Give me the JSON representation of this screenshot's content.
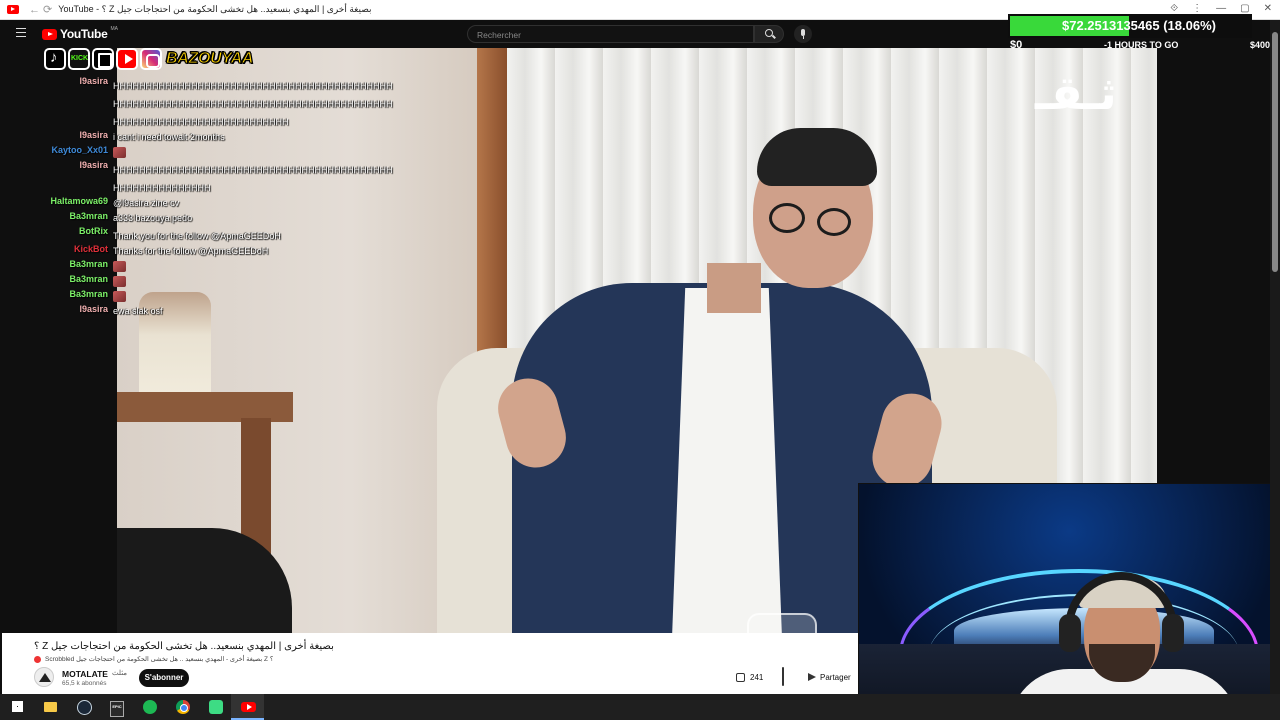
{
  "browser": {
    "tab_title": "YouTube - ؟ Z بصيغة أخرى | المهدي بنسعيد.. هل تخشى الحكومة من احتجاجات جيل",
    "nav_glyphs": "← ⟳"
  },
  "masthead": {
    "logo_text": "YouTube",
    "region": "MA",
    "search_placeholder": "Rechercher"
  },
  "donation_goal": {
    "amount_text": "$72.2513135465 (18.06%)",
    "progress_percent": 18.06,
    "min_label": "$0",
    "time_left": "-1 HOURS TO GO",
    "max_label": "$400",
    "fill_color": "#39d93a"
  },
  "overlay": {
    "streamer_name": "BAZOUYAA",
    "kick_label": "KICK",
    "socials": [
      "tiktok-icon",
      "kick-icon",
      "twitch-icon",
      "youtube-icon",
      "instagram-icon"
    ]
  },
  "chat": [
    {
      "user": "l9asira",
      "color": "#f0b0b0",
      "msg": "HHHHHHHHHHHHHHHHHHHHHHHHHHHHHHHHHHHHHHHHHHHHHHHHHHHHHHHHHHHHHHHHHHHHHHHHHHHHHHHHHHHHHHHHHHHHHHHHHHHHHHHHHHHHHHHHH"
    },
    {
      "user": "l9asira",
      "color": "#f0b0b0",
      "msg": "i cant i need towait 2months"
    },
    {
      "user": "Kaytoo_Xx01",
      "color": "#3f8ad8",
      "msg": "",
      "emote": true
    },
    {
      "user": "l9asira",
      "color": "#f0b0b0",
      "msg": "HHHHHHHHHHHHHHHHHHHHHHHHHHHHHHHHHHHHHHHHHHHHHHHHHHHHHHHHHH"
    },
    {
      "user": "Haltamowa69",
      "color": "#7cf068",
      "msg": "@l9asira zine cv"
    },
    {
      "user": "Ba3mran",
      "color": "#7cf068",
      "msg": "a333 bazouya pedo"
    },
    {
      "user": "BotRix",
      "color": "#7cf068",
      "msg": "Thank you for the follow @ApmaGEEDoH"
    },
    {
      "user": "KickBot",
      "color": "#e0303a",
      "msg": "Thanks for the follow @ApmaGEEDoH"
    },
    {
      "user": "Ba3mran",
      "color": "#7cf068",
      "msg": "",
      "emote": true
    },
    {
      "user": "Ba3mran",
      "color": "#7cf068",
      "msg": "",
      "emote": true
    },
    {
      "user": "Ba3mran",
      "color": "#7cf068",
      "msg": "",
      "emote": true
    },
    {
      "user": "l9asira",
      "color": "#f0b0b0",
      "msg": "ewa slak osf"
    }
  ],
  "video": {
    "channel_logo_text": "ثـقـ"
  },
  "info": {
    "title": "؟ Z بصيغة أخرى | المهدي بنسعيد.. هل تخشى الحكومة من احتجاجات جيل",
    "scrobbled": "Scrobbled بصيغة أخرى - المهدي بنسعيد .. هل تخشى الحكومة من احتجاجات جيل Z ؟",
    "channel_name": "MOTALATE",
    "channel_arabic": "مثلث",
    "subscribers": "65,5 k abonnés",
    "subscribe_label": "S'abonner",
    "likes": "241",
    "share_label": "Partager"
  },
  "taskbar": [
    "windows-start-icon",
    "file-explorer-icon",
    "steam-icon",
    "epic-games-icon",
    "spotify-icon",
    "chrome-icon",
    "game-app-icon",
    "youtube-app-icon"
  ]
}
